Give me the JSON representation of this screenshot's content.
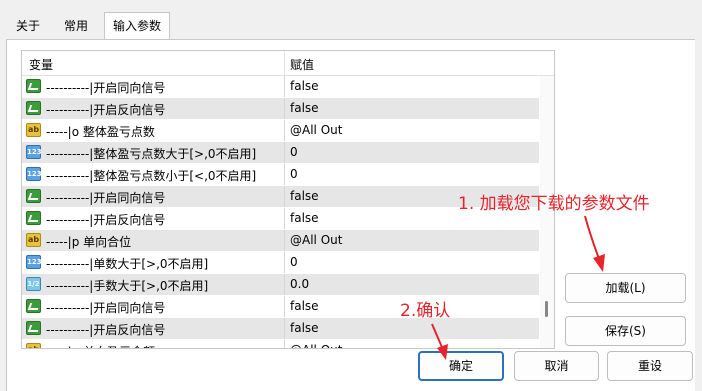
{
  "tabs": [
    {
      "label": "关于"
    },
    {
      "label": "常用"
    },
    {
      "label": "输入参数"
    }
  ],
  "grid": {
    "col_variable": "变量",
    "col_value": "赋值",
    "rows": [
      {
        "icon": "bool-icon",
        "name": "----------|开启同向信号",
        "value": "false"
      },
      {
        "icon": "bool-icon",
        "name": "----------|开启反向信号",
        "value": "false"
      },
      {
        "icon": "string-icon",
        "name": "-----|o 整体盈亏点数",
        "value": "@All Out"
      },
      {
        "icon": "integer-icon",
        "name": "----------|整体盈亏点数大于[>,0不启用]",
        "value": "0"
      },
      {
        "icon": "integer-icon",
        "name": "----------|整体盈亏点数小于[<,0不启用]",
        "value": "0"
      },
      {
        "icon": "bool-icon",
        "name": "----------|开启同向信号",
        "value": "false"
      },
      {
        "icon": "bool-icon",
        "name": "----------|开启反向信号",
        "value": "false"
      },
      {
        "icon": "string-icon",
        "name": "-----|p 单向合位",
        "value": "@All Out"
      },
      {
        "icon": "integer-icon",
        "name": "----------|单数大于[>,0不启用]",
        "value": "0"
      },
      {
        "icon": "double-icon",
        "name": "----------|手数大于[>,0不启用]",
        "value": "0.0"
      },
      {
        "icon": "bool-icon",
        "name": "----------|开启同向信号",
        "value": "false"
      },
      {
        "icon": "bool-icon",
        "name": "----------|开启反向信号",
        "value": "false"
      },
      {
        "icon": "string-icon",
        "name": "-----|q 单向盈亏金额",
        "value": "@All Out"
      }
    ],
    "icon_text": {
      "string": "ab",
      "integer": "123",
      "double": "1/2"
    }
  },
  "buttons": {
    "load": "加载(L)",
    "save": "保存(S)",
    "ok": "确定",
    "cancel": "取消",
    "reset": "重设"
  },
  "annotations": {
    "step1": "1. 加载您下载的参数文件",
    "step2": "2.确认"
  },
  "colors": {
    "annotation": "#e8232a",
    "accent": "#2f6fbf"
  }
}
